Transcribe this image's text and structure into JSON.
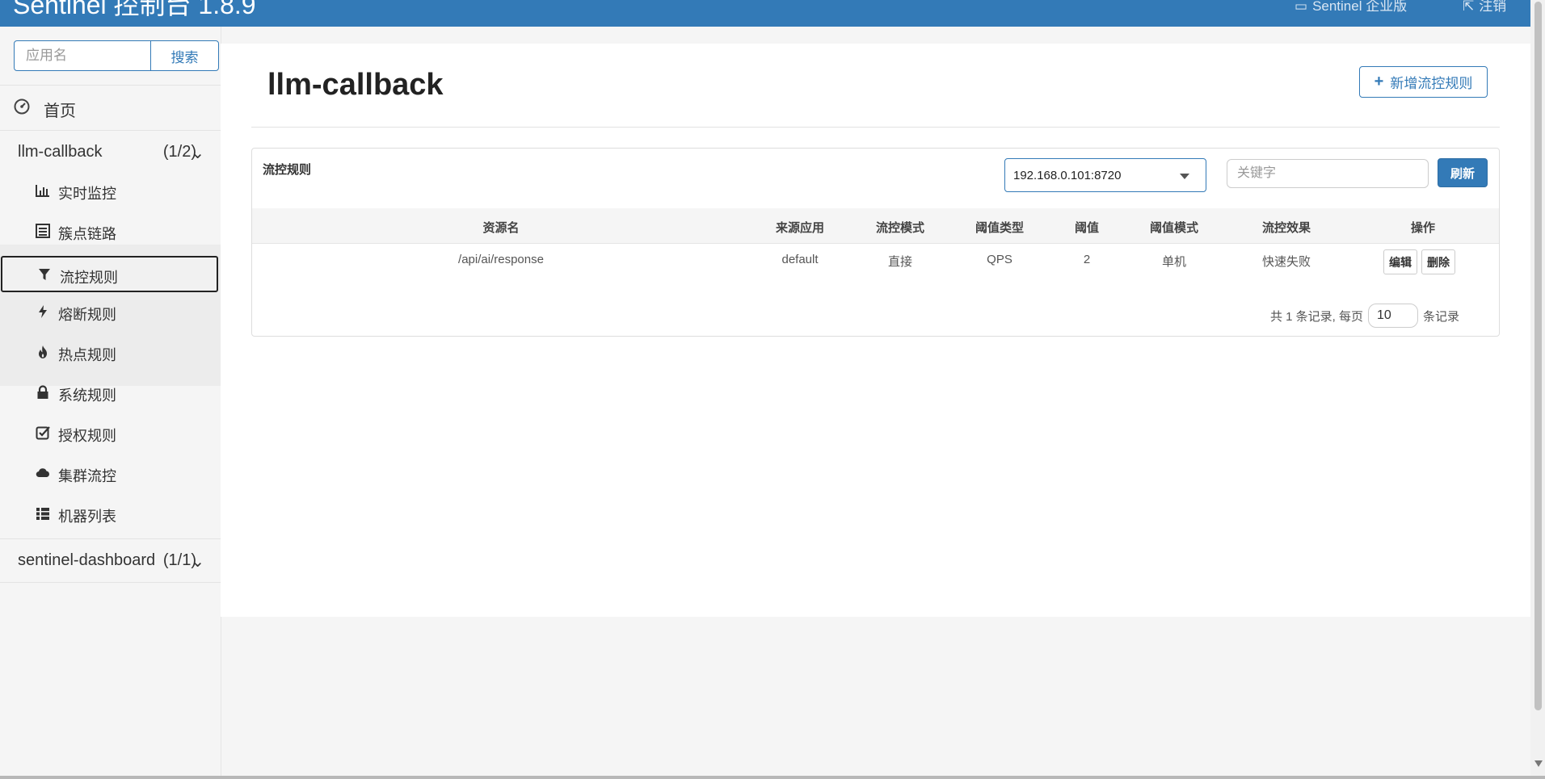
{
  "navbar": {
    "brand": "Sentinel 控制台 1.8.9",
    "enterprise": "Sentinel 企业版",
    "logout": "注销"
  },
  "sidebar": {
    "search_placeholder": "应用名",
    "search_button": "搜索",
    "home": "首页",
    "apps": [
      {
        "name": "llm-callback",
        "count": "(1/2)"
      },
      {
        "name": "sentinel-dashboard",
        "count": "(1/1)"
      }
    ],
    "menu": [
      {
        "label": "实时监控",
        "icon": "bar-chart-icon"
      },
      {
        "label": "簇点链路",
        "icon": "list-alt-icon"
      },
      {
        "label": "流控规则",
        "icon": "filter-icon"
      },
      {
        "label": "熔断规则",
        "icon": "flash-icon"
      },
      {
        "label": "热点规则",
        "icon": "fire-icon"
      },
      {
        "label": "系统规则",
        "icon": "lock-icon"
      },
      {
        "label": "授权规则",
        "icon": "check-icon"
      },
      {
        "label": "集群流控",
        "icon": "cloud-icon"
      },
      {
        "label": "机器列表",
        "icon": "th-list-icon"
      }
    ]
  },
  "main": {
    "title": "llm-callback",
    "add_button": "新增流控规则",
    "panel_title": "流控规则",
    "machine_select": "192.168.0.101:8720",
    "keyword_placeholder": "关键字",
    "refresh_button": "刷新",
    "columns": [
      "资源名",
      "来源应用",
      "流控模式",
      "阈值类型",
      "阈值",
      "阈值模式",
      "流控效果",
      "操作"
    ],
    "rows": [
      [
        "/api/ai/response",
        "default",
        "直接",
        "QPS",
        "2",
        "单机",
        "快速失败"
      ]
    ],
    "edit_button": "编辑",
    "delete_button": "删除",
    "pager": {
      "prefix": "共 1 条记录, 每页",
      "page_size": "10",
      "suffix": "条记录"
    }
  },
  "colors": {
    "primary": "#337ab7",
    "background": "#f5f5f5"
  }
}
